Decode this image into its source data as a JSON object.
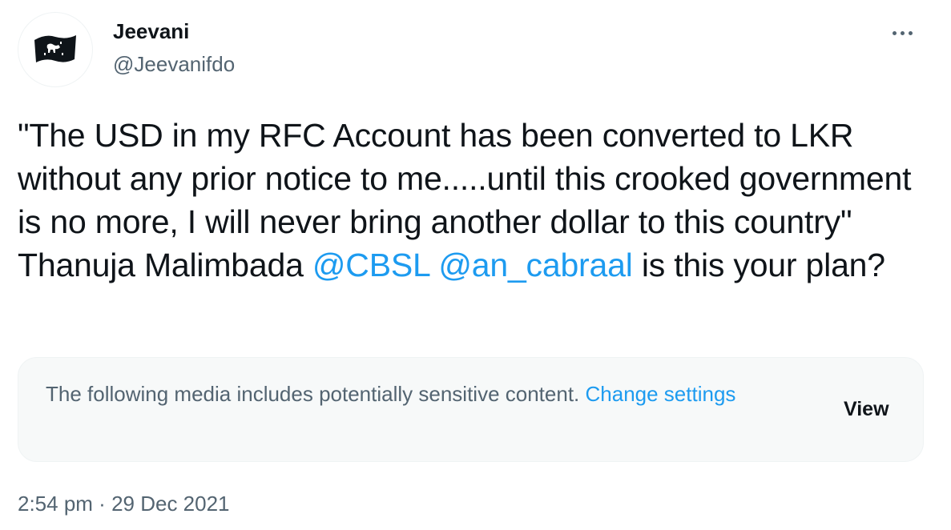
{
  "author": {
    "display_name": "Jeevani",
    "handle": "@Jeevanifdo",
    "avatar_icon": "sri-lanka-flag-icon"
  },
  "tweet": {
    "text_before": "\"The USD in my RFC Account has been converted to LKR without any prior notice to me.....until this crooked government is no more, I will never bring another dollar to this country\" Thanuja Malimbada ",
    "mention_1": "@CBSL",
    "space": " ",
    "mention_2": "@an_cabraal",
    "text_after": " is this your plan?"
  },
  "sensitive_notice": {
    "message": "The following media includes potentially sensitive content. ",
    "change_settings_label": "Change settings",
    "view_label": "View"
  },
  "timestamp": {
    "time": "2:54 pm",
    "separator": " · ",
    "date": "29 Dec 2021"
  },
  "colors": {
    "link": "#1d9bf0",
    "secondary_text": "#536471",
    "primary_text": "#0f1419",
    "notice_background": "#f7f9f9"
  },
  "icons": {
    "more": "more-options-icon"
  }
}
